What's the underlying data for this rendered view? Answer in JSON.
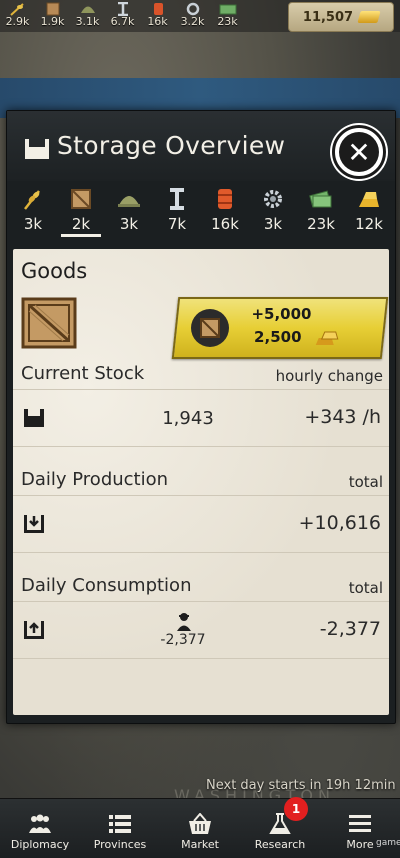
{
  "top_resources": [
    {
      "icon": "grain-icon",
      "value": "2.9k"
    },
    {
      "icon": "crate-icon",
      "value": "1.9k"
    },
    {
      "icon": "helmet-icon",
      "value": "3.1k"
    },
    {
      "icon": "steel-beam-icon",
      "value": "6.7k"
    },
    {
      "icon": "oil-barrel-icon",
      "value": "16k"
    },
    {
      "icon": "gear-icon",
      "value": "3.2k"
    },
    {
      "icon": "cash-icon",
      "value": "23k"
    }
  ],
  "money": {
    "value": "11,507"
  },
  "panel": {
    "title": "Storage Overview"
  },
  "tabs": [
    {
      "icon": "grain-icon",
      "value": "3k"
    },
    {
      "icon": "crate-icon",
      "value": "2k",
      "active": true
    },
    {
      "icon": "helmet-icon",
      "value": "3k"
    },
    {
      "icon": "steel-beam-icon",
      "value": "7k"
    },
    {
      "icon": "oil-barrel-icon",
      "value": "16k"
    },
    {
      "icon": "gear-icon",
      "value": "3k"
    },
    {
      "icon": "cash-icon",
      "value": "23k"
    },
    {
      "icon": "gold-icon",
      "value": "12k"
    }
  ],
  "goods": {
    "title": "Goods",
    "bonus_amount": "+5,000",
    "bonus_cost": "2,500"
  },
  "current_stock": {
    "label": "Current Stock",
    "right_label": "hourly change",
    "value": "1,943",
    "change": "+343 /h"
  },
  "daily_production": {
    "label": "Daily Production",
    "right_label": "total",
    "value": "+10,616"
  },
  "daily_consumption": {
    "label": "Daily Consumption",
    "right_label": "total",
    "population_value": "-2,377",
    "value": "-2,377"
  },
  "map": {
    "next_day": "Next day starts in 19h 12min",
    "city": "WASHINGTON, D.C."
  },
  "nav": [
    {
      "label": "Diplomacy",
      "icon": "people-icon"
    },
    {
      "label": "Provinces",
      "icon": "list-icon"
    },
    {
      "label": "Market",
      "icon": "basket-icon"
    },
    {
      "label": "Research",
      "icon": "flask-icon",
      "badge": "1"
    },
    {
      "label": "More",
      "icon": "menu-icon"
    }
  ],
  "watermark": "game"
}
